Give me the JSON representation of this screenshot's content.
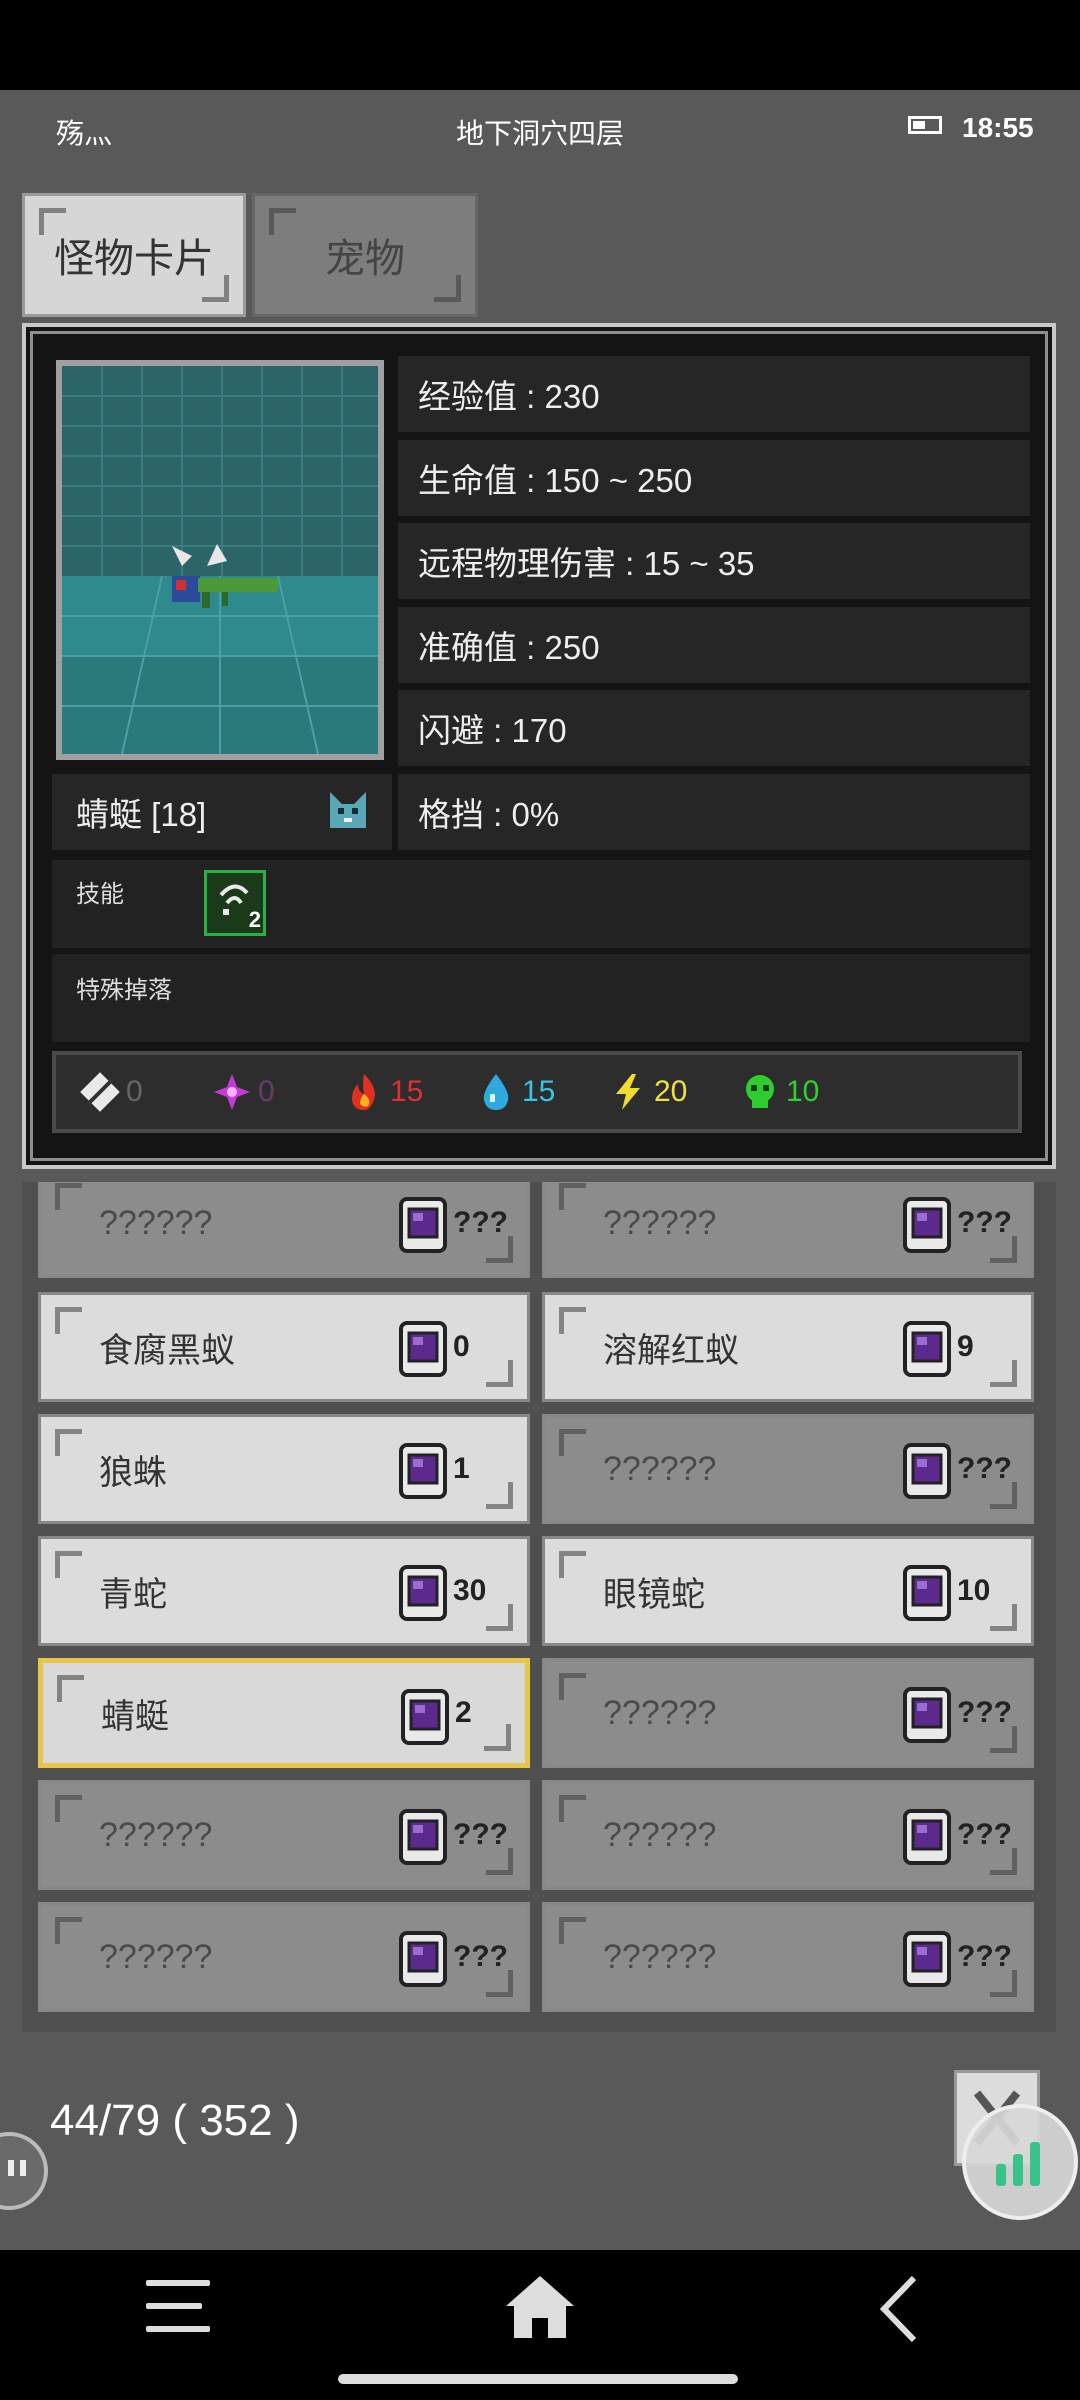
{
  "status_bar": {
    "left_text": "殇灬",
    "location": "地下洞穴四层",
    "time": "18:55"
  },
  "tabs": [
    {
      "label": "怪物卡片"
    },
    {
      "label": "宠物"
    }
  ],
  "monster": {
    "name": "蜻蜓 [18]",
    "stats": [
      "经验值 : 230",
      "生命值 : 150 ~ 250",
      "远程物理伤害 : 15 ~ 35",
      "准确值 : 250",
      "闪避 : 170",
      "格挡 : 0%"
    ],
    "skills_label": "技能",
    "skill_level": "2",
    "drops_label": "特殊掉落",
    "resistances": [
      {
        "icon": "physical-icon",
        "value": "0",
        "color": "#666666"
      },
      {
        "icon": "magic-icon",
        "value": "0",
        "color": "#6a3a6a"
      },
      {
        "icon": "fire-icon",
        "value": "15",
        "color": "#e03030"
      },
      {
        "icon": "water-icon",
        "value": "15",
        "color": "#39c3e6"
      },
      {
        "icon": "lightning-icon",
        "value": "20",
        "color": "#f0e040"
      },
      {
        "icon": "poison-icon",
        "value": "10",
        "color": "#2fd02f"
      }
    ]
  },
  "cards": [
    {
      "name": "??????",
      "count": "???",
      "state": "unknown"
    },
    {
      "name": "??????",
      "count": "???",
      "state": "unknown"
    },
    {
      "name": "食腐黑蚁",
      "count": "0",
      "state": "known"
    },
    {
      "name": "溶解红蚁",
      "count": "9",
      "state": "known"
    },
    {
      "name": "狼蛛",
      "count": "1",
      "state": "known"
    },
    {
      "name": "??????",
      "count": "???",
      "state": "unknown"
    },
    {
      "name": "青蛇",
      "count": "30",
      "state": "known"
    },
    {
      "name": "眼镜蛇",
      "count": "10",
      "state": "known"
    },
    {
      "name": "蜻蜓",
      "count": "2",
      "state": "selected"
    },
    {
      "name": "??????",
      "count": "???",
      "state": "unknown"
    },
    {
      "name": "??????",
      "count": "???",
      "state": "unknown"
    },
    {
      "name": "??????",
      "count": "???",
      "state": "unknown"
    },
    {
      "name": "??????",
      "count": "???",
      "state": "unknown"
    },
    {
      "name": "??????",
      "count": "???",
      "state": "unknown"
    }
  ],
  "footer": {
    "progress": "44/79 ( 352 )"
  }
}
